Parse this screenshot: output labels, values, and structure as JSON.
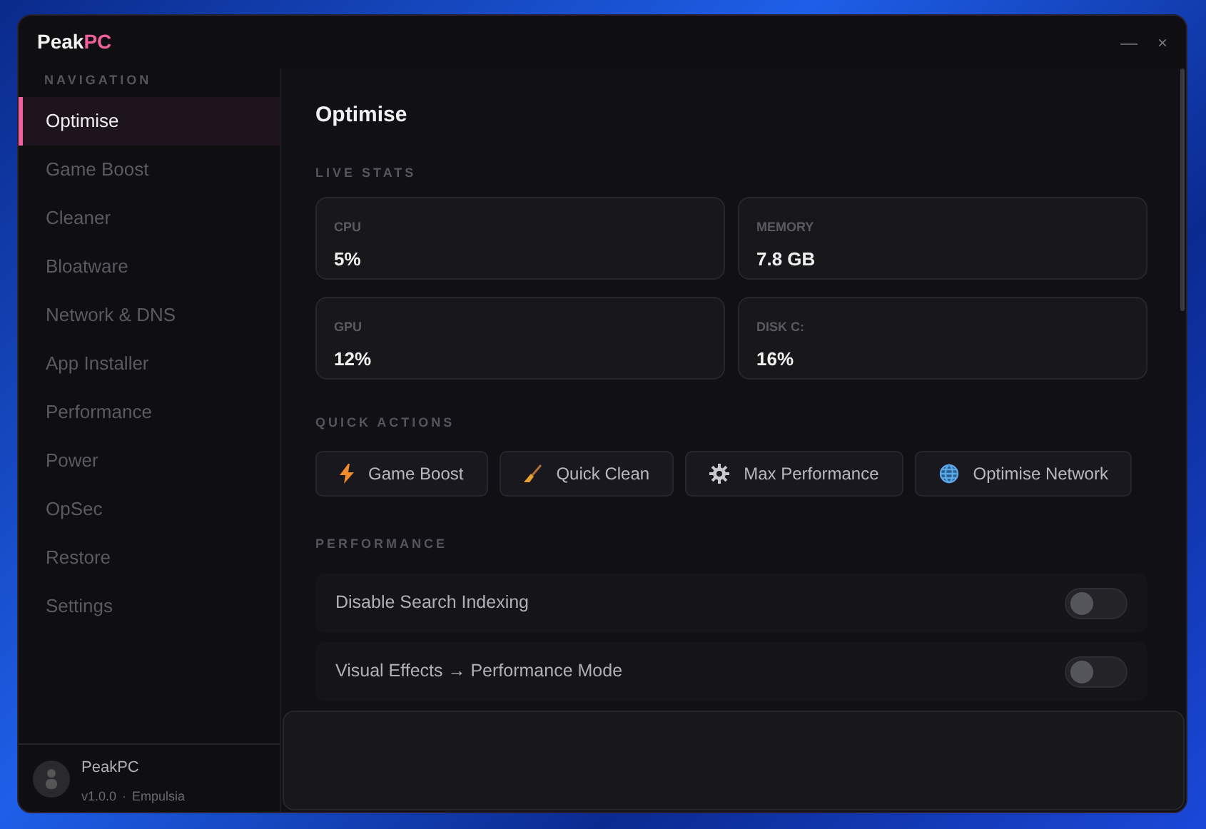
{
  "window": {
    "title_parts": [
      {
        "text": "Peak",
        "accent": false
      },
      {
        "text": "PC",
        "accent": true
      }
    ],
    "controls": [
      "—",
      "×"
    ]
  },
  "sidebar": {
    "heading": "NAVIGATION",
    "items": [
      {
        "label": "Optimise",
        "selected": true
      },
      {
        "label": "Game Boost",
        "selected": false
      },
      {
        "label": "Cleaner",
        "selected": false
      },
      {
        "label": "Bloatware",
        "selected": false
      },
      {
        "label": "Network & DNS",
        "selected": false
      },
      {
        "label": "App Installer",
        "selected": false
      },
      {
        "label": "Performance",
        "selected": false
      },
      {
        "label": "Power",
        "selected": false
      },
      {
        "label": "OpSec",
        "selected": false
      },
      {
        "label": "Restore",
        "selected": false
      },
      {
        "label": "Settings",
        "selected": false
      }
    ],
    "footer": {
      "name": "PeakPC",
      "version": "v1.0.0",
      "separator": "·",
      "author": "Empulsia"
    }
  },
  "page": {
    "title": "Optimise",
    "live_stats": {
      "heading": "LIVE STATS",
      "stats": [
        {
          "label": "CPU",
          "value": "5%"
        },
        {
          "label": "MEMORY",
          "value": "7.8 GB"
        },
        {
          "label": "GPU",
          "value": "12%"
        },
        {
          "label": "DISK C:",
          "value": "16%"
        }
      ]
    },
    "quick_actions": {
      "heading": "QUICK ACTIONS",
      "buttons": [
        {
          "label": "Game Boost",
          "kind": "bolt"
        },
        {
          "label": "Quick Clean",
          "kind": "broom"
        },
        {
          "label": "Max Performance",
          "kind": "gear"
        },
        {
          "label": "Optimise Network",
          "kind": "globe"
        }
      ]
    },
    "performance": {
      "heading": "PERFORMANCE",
      "toggles": [
        {
          "label": "Disable Search Indexing",
          "on": false
        },
        {
          "label": "Visual Effects → Performance Mode",
          "on": false
        }
      ]
    }
  }
}
